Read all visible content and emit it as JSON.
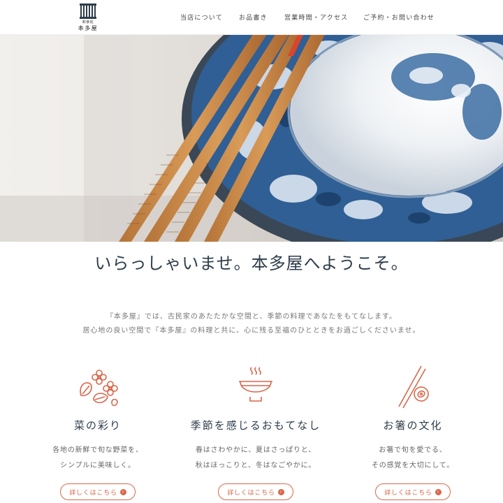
{
  "header": {
    "logo": {
      "sub": "和食処",
      "name": "本多屋"
    },
    "nav": [
      {
        "label": "当店について"
      },
      {
        "label": "お品書き"
      },
      {
        "label": "営業時間・アクセス"
      },
      {
        "label": "ご予約・お問い合わせ"
      }
    ]
  },
  "welcome": {
    "title": "いらっしゃいませ。本多屋へようこそ。"
  },
  "intro": {
    "lines": [
      "『本多屋』では、古民家のあたたかな空間と、季節の料理であなたをもてなします。",
      "居心地の良い空間で『本多屋』の料理と共に、心に残る至福のひとときをお過ごしくださいませ。"
    ]
  },
  "features": [
    {
      "title": "菜の彩り",
      "icon": "flower-leaf-icon",
      "desc": [
        "各地の新鮮で旬な野菜を、",
        "シンプルに美味しく。"
      ],
      "button": "詳しくはこちら"
    },
    {
      "title": "季節を感じるおもてなし",
      "icon": "steaming-bowl-icon",
      "desc": [
        "春はさわやかに、夏はさっぱりと、",
        "秋はほっこりと、冬はなごやかに。"
      ],
      "button": "詳しくはこちら"
    },
    {
      "title": "お箸の文化",
      "icon": "chopsticks-icon",
      "desc": [
        "お箸で旬を愛でる、",
        "その感覚を大切にして。"
      ],
      "button": "詳しくはこちら"
    }
  ],
  "colors": {
    "accent": "#d9674b",
    "heading": "#2e3d4b",
    "bowl_blue": "#2f5f94"
  }
}
